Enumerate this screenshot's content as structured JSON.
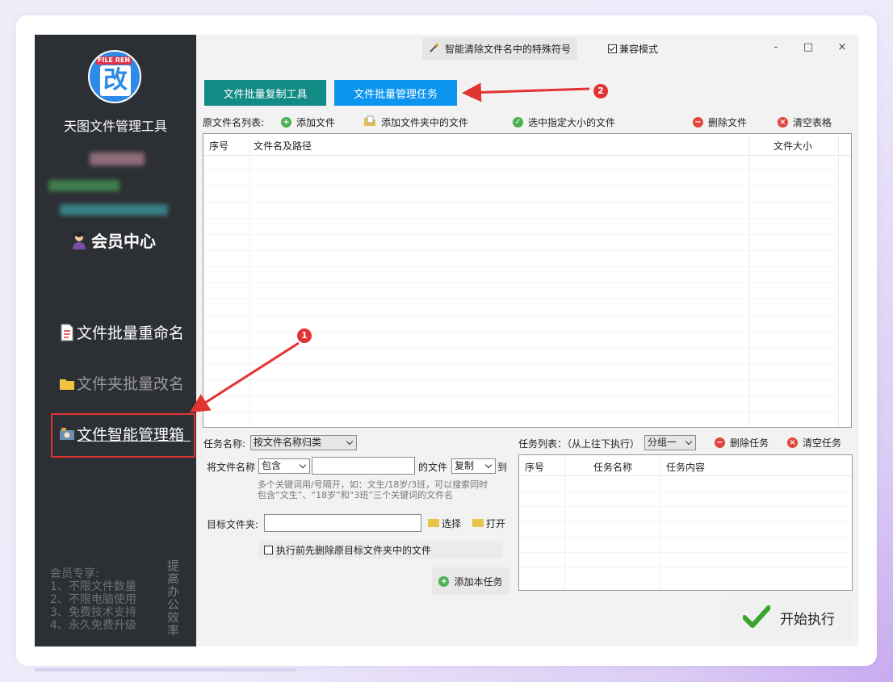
{
  "sidebar": {
    "app_name": "天图文件管理工具",
    "vip_label": "会员中心",
    "nav_items": [
      {
        "label": "文件批量重命名",
        "icon": "document-icon"
      },
      {
        "label": "文件夹批量改名",
        "icon": "folder-icon"
      },
      {
        "label": "文件智能管理箱",
        "icon": "smart-box-icon"
      }
    ],
    "perks_title": "会员专享:",
    "perks": [
      "1、不限文件数量",
      "2、不限电脑使用",
      "3、免费技术支持",
      "4、永久免费升级"
    ],
    "vertical_text": "提高办公效率",
    "logo_tag": "FILE REN",
    "logo_char": "改"
  },
  "header": {
    "special_button": "智能清除文件名中的特殊符号",
    "compat_label": "兼容模式",
    "compat_checked": true,
    "window_controls": [
      "-",
      "□",
      "×"
    ]
  },
  "tabs": [
    {
      "label": "文件批量复制工具"
    },
    {
      "label": "文件批量管理任务"
    }
  ],
  "file_list": {
    "label": "原文件名列表:",
    "actions": {
      "add_file": "添加文件",
      "add_folder_files": "添加文件夹中的文件",
      "select_by_size": "选中指定大小的文件",
      "delete_file": "删除文件",
      "clear_table": "清空表格"
    },
    "columns": [
      "序号",
      "文件名及路径",
      "文件大小"
    ]
  },
  "task_form": {
    "task_name_label": "任务名称:",
    "task_name_value": "按文件名称归类",
    "file_name_prefix": "将文件名称",
    "match_mode": "包含",
    "keyword_value": "",
    "file_suffix": "的文件",
    "operation": "复制",
    "to_label": "到",
    "hint_line1": "多个关键词用/号隔开，如：文生/18岁/3班，可以搜索同时",
    "hint_line2": "包含“文生”、“18岁”和“3班”三个关键词的文件名",
    "target_folder_label": "目标文件夹:",
    "target_folder_value": "",
    "choose_button": "选择",
    "open_button": "打开",
    "delete_before_label": "执行前先删除原目标文件夹中的文件",
    "add_task_button": "添加本任务"
  },
  "task_list": {
    "label": "任务列表：（从上往下执行）",
    "group": "分组一",
    "delete_task": "删除任务",
    "clear_tasks": "清空任务",
    "columns": [
      "序号",
      "任务名称",
      "任务内容"
    ]
  },
  "run_button": "开始执行",
  "annotations": {
    "marker1": "1",
    "marker2": "2"
  },
  "colors": {
    "tab_teal": "#128a86",
    "tab_blue": "#0c95ef",
    "sidebar_bg": "#2c2f33",
    "annotation_red": "#e23333"
  }
}
